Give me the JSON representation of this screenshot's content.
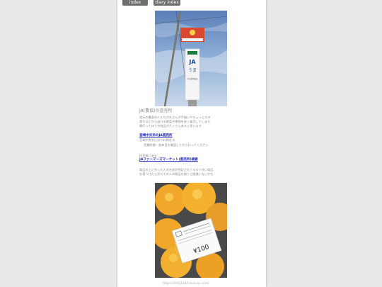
{
  "nav": {
    "index_label": "index",
    "diary_index_label": "diary index"
  },
  "photos": [
    {
      "name": "ja-signpost-photo",
      "sign_brand": "JA",
      "sign_text": "うま",
      "sign_subtext": "川久保中央店"
    },
    {
      "name": "oranges-bag-photo",
      "price_label": "¥100"
    }
  ],
  "article": {
    "heading": "JA(農協)の直売所",
    "para1_line1": "地元の農家の人たちが丸さんが不揃いやちょっとカタ",
    "para1_line2": "落ちなどから出せる野菜や果物を安く販売しています",
    "para1_line3": "朝行ったほうが商品がたくさんあると思います",
    "link1": "宮崎中央市のJA直売所",
    "link1_note": "宮崎中央市にはうれ得ある",
    "link1_note2": "営業時間・定休日を確認してから行ってください",
    "section2": "JA宮崎にある",
    "link2": "JAファーマーズマーケット(直売所)検索",
    "para2_line1": "商品の上に作った人の名前が明記されてるので良い商品",
    "para2_line2": "を見つけたら次もその人の商品を買うと間違いないかも"
  },
  "footer": {
    "url": "https://4912284.teacup.com/"
  }
}
